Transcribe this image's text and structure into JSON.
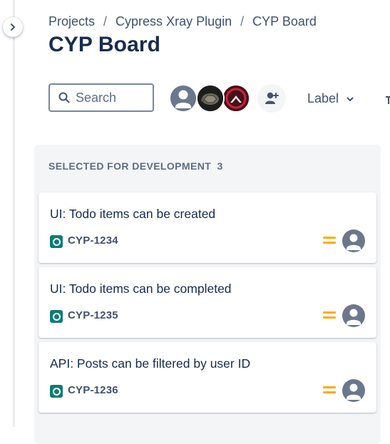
{
  "breadcrumb": {
    "items": [
      "Projects",
      "Cypress Xray Plugin",
      "CYP Board"
    ],
    "separator": "/"
  },
  "page": {
    "title": "CYP Board"
  },
  "search": {
    "placeholder": "Search",
    "value": ""
  },
  "filters": {
    "label_dropdown": "Label"
  },
  "avatars": [
    {
      "type": "default-user-icon"
    },
    {
      "type": "photo-turtle"
    },
    {
      "type": "photo-red-logo"
    }
  ],
  "add_people": {
    "icon": "add-person-icon"
  },
  "board": {
    "column": {
      "title": "SELECTED FOR DEVELOPMENT",
      "count": "3",
      "cards": [
        {
          "title": "UI: Todo items can be created",
          "key": "CYP-1234",
          "priority": "medium",
          "issue_type_color": "#0f7b75"
        },
        {
          "title": "UI: Todo items can be completed",
          "key": "CYP-1235",
          "priority": "medium",
          "issue_type_color": "#0f7b75"
        },
        {
          "title": "API: Posts can be filtered by user ID",
          "key": "CYP-1236",
          "priority": "medium",
          "issue_type_color": "#0f7b75"
        }
      ]
    }
  },
  "colors": {
    "priority_medium": "#ffab00",
    "text_primary": "#172b4d",
    "text_secondary": "#42526e",
    "column_bg": "#f4f5f7"
  }
}
